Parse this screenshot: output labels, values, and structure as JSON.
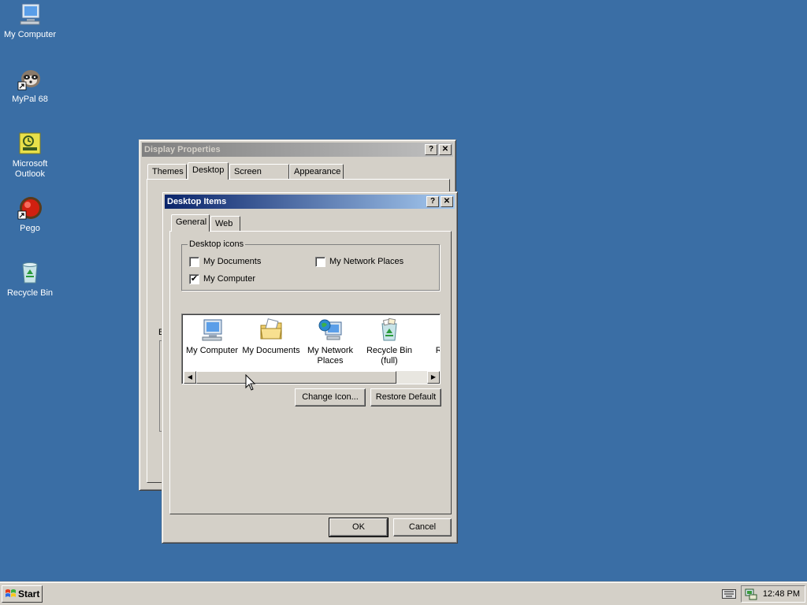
{
  "desktop": {
    "icons": [
      {
        "label": "My Computer",
        "icon": "my-computer-icon"
      },
      {
        "label": "MyPal 68",
        "icon": "raccoon-shortcut-icon"
      },
      {
        "label": "Microsoft Outlook",
        "icon": "outlook-icon"
      },
      {
        "label": "Pego",
        "icon": "red-ball-shortcut-icon"
      },
      {
        "label": "Recycle Bin",
        "icon": "recycle-bin-icon"
      }
    ]
  },
  "display_properties": {
    "title": "Display Properties",
    "tabs": [
      "Themes",
      "Desktop",
      "Screen Saver",
      "Appearance"
    ],
    "selected_tab": "Desktop",
    "partial_label": "B"
  },
  "desktop_items": {
    "title": "Desktop Items",
    "tabs": [
      "General",
      "Web"
    ],
    "selected_tab": "General",
    "group_title": "Desktop icons",
    "checkboxes": [
      {
        "label": "My Documents",
        "checked": false
      },
      {
        "label": "My Network Places",
        "checked": false
      },
      {
        "label": "My Computer",
        "checked": true
      }
    ],
    "list_items": [
      {
        "label": "My Computer",
        "icon": "my-computer-icon"
      },
      {
        "label": "My Documents",
        "icon": "my-documents-icon"
      },
      {
        "label": "My Network Places",
        "icon": "network-places-icon"
      },
      {
        "label": "Recycle Bin (full)",
        "icon": "recycle-bin-full-icon"
      },
      {
        "label": "Rec (e",
        "icon": "recycle-bin-empty-icon"
      }
    ],
    "change_icon_label": "Change Icon...",
    "restore_default_label": "Restore Default",
    "ok_label": "OK",
    "cancel_label": "Cancel",
    "check_mark": "✔"
  },
  "title_buttons": {
    "help": "?",
    "close": "✕"
  },
  "taskbar": {
    "start_label": "Start",
    "clock": "12:48 PM"
  },
  "colors": {
    "desktop": "#3a6ea5",
    "active_title": "#0a246a",
    "face": "#d4d0c8"
  }
}
